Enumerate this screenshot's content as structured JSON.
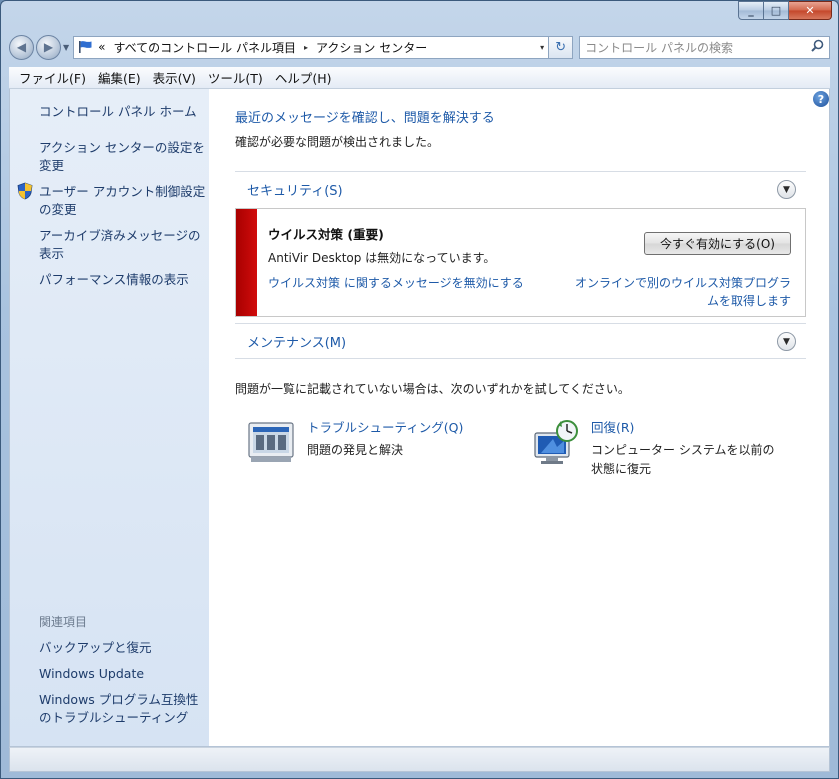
{
  "window": {
    "caption_min": "_",
    "caption_max": "□",
    "caption_close": "✕"
  },
  "address": {
    "overflow": "«",
    "crumbs": [
      "すべてのコントロール パネル項目",
      "アクション センター"
    ],
    "separator": "▸",
    "dropdown": "▾",
    "refresh": "↻"
  },
  "search": {
    "placeholder": "コントロール パネルの検索",
    "icon": "search-icon"
  },
  "menu": [
    "ファイル(F)",
    "編集(E)",
    "表示(V)",
    "ツール(T)",
    "ヘルプ(H)"
  ],
  "sidebar": {
    "home": "コントロール パネル ホーム",
    "items": [
      "アクション センターの設定を変更",
      "ユーザー アカウント制御設定の変更",
      "アーカイブ済みメッセージの表示",
      "パフォーマンス情報の表示"
    ],
    "related_title": "関連項目",
    "related": [
      "バックアップと復元",
      "Windows Update",
      "Windows プログラム互換性のトラブルシューティング"
    ]
  },
  "main": {
    "heading": "最近のメッセージを確認し、問題を解決する",
    "subheading": "確認が必要な問題が検出されました。",
    "security_section": "セキュリティ(S)",
    "alert": {
      "title": "ウイルス対策 (重要)",
      "description": "AntiVir Desktop は無効になっています。",
      "action_button": "今すぐ有効にする(O)",
      "disable_link": "ウイルス対策 に関するメッセージを無効にする",
      "online_link": "オンラインで別のウイルス対策プログラムを取得します"
    },
    "maintenance_section": "メンテナンス(M)",
    "not_listed_text": "問題が一覧に記載されていない場合は、次のいずれかを試してください。",
    "tools": [
      {
        "title": "トラブルシューティング(Q)",
        "description": "問題の発見と解決"
      },
      {
        "title": "回復(R)",
        "description": "コンピューター システムを以前の状態に復元"
      }
    ],
    "help": "?"
  },
  "colors": {
    "link": "#1e5aa8",
    "alert_bar": "#c00000",
    "sidebar_bg": "#dde7f4"
  }
}
